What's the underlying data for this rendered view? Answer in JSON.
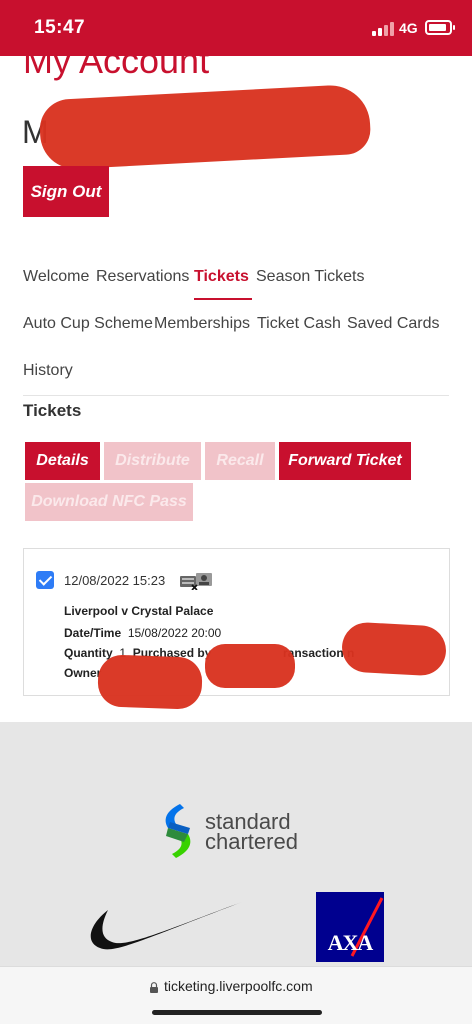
{
  "status_bar": {
    "time": "15:47",
    "network": "4G"
  },
  "page": {
    "title": "My Account",
    "user_name_visible": "M"
  },
  "sign_out_label": "Sign Out",
  "nav": {
    "items": [
      {
        "label": "Welcome"
      },
      {
        "label": "Reservations"
      },
      {
        "label": "Tickets",
        "active": true
      },
      {
        "label": "Season Tickets"
      },
      {
        "label": "Auto Cup Scheme"
      },
      {
        "label": "Memberships"
      },
      {
        "label": "Ticket Cash"
      },
      {
        "label": "Saved Cards"
      },
      {
        "label": "History"
      }
    ]
  },
  "section_title": "Tickets",
  "actions": [
    {
      "label": "Details",
      "enabled": true
    },
    {
      "label": "Distribute",
      "enabled": false
    },
    {
      "label": "Recall",
      "enabled": false
    },
    {
      "label": "Forward Ticket",
      "enabled": true
    },
    {
      "label": "Download NFC Pass",
      "enabled": false
    }
  ],
  "ticket": {
    "checked": true,
    "created": "12/08/2022 15:23",
    "match": "Liverpool v Crystal Palace",
    "datetime_label": "Date/Time",
    "datetime_value": "15/08/2022 20:00",
    "quantity_label": "Quantity",
    "quantity_value": "1",
    "purchased_by_label": "Purchased by",
    "transaction_label_partial": "ransaction n",
    "owner_label": "Owner"
  },
  "sponsors": {
    "standard_chartered_line1": "standard",
    "standard_chartered_line2": "chartered",
    "axa": "AXA"
  },
  "url_bar": {
    "url": "ticketing.liverpoolfc.com"
  },
  "colors": {
    "brand_red": "#c8102e",
    "disabled_red": "#f1c3c9",
    "checkbox_blue": "#2e7cf6",
    "axa_blue": "#00008f"
  }
}
